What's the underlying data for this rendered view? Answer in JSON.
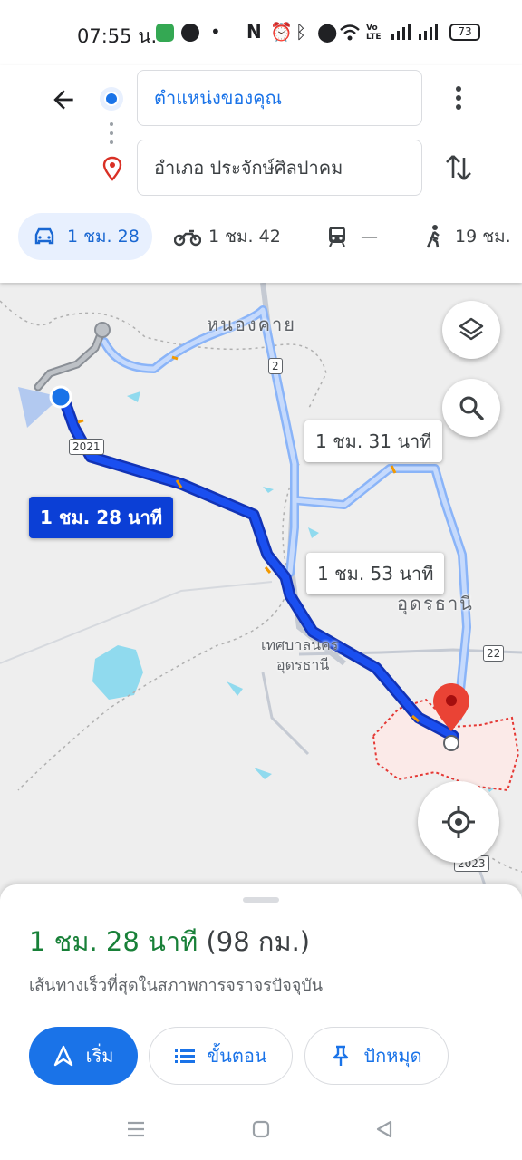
{
  "status_bar": {
    "time": "07:55 น.",
    "app_icons": [
      "messages-app-icon",
      "line-app-icon"
    ],
    "system_icons": [
      "nfc-icon",
      "alarm-icon",
      "bluetooth-icon",
      "location-icon",
      "wifi-icon",
      "volte-icon",
      "signal-icon"
    ],
    "volte_label": "Vo\nLTE",
    "battery": "73"
  },
  "header": {
    "origin": "ตำแหน่งของคุณ",
    "destination": "อำเภอ ประจักษ์ศิลปาคม",
    "modes": [
      {
        "icon": "car-icon",
        "label": "1 ชม. 28",
        "selected": true
      },
      {
        "icon": "motorcycle-icon",
        "label": "1 ชม. 42"
      },
      {
        "icon": "transit-icon",
        "label": "—"
      },
      {
        "icon": "walk-icon",
        "label": "19 ชม."
      }
    ]
  },
  "map": {
    "place_labels": [
      "หนองคาย",
      "อุดรธานี",
      "เทศบาลนคร",
      "อุดรธานี"
    ],
    "road_shields": [
      "2",
      "2021",
      "22",
      "2023"
    ],
    "route_labels": {
      "primary": "1 ชม. 28 นาที",
      "alt1": "1 ชม. 31 นาที",
      "alt2": "1 ชม. 53 นาที"
    }
  },
  "sheet": {
    "duration": "1 ชม. 28 นาที",
    "distance": "(98 กม.)",
    "description": "เส้นทางเร็วที่สุดในสภาพการจราจรปัจจุบัน",
    "start_label": "เริ่ม",
    "steps_label": "ขั้นตอน",
    "pin_label": "ปักหมุด"
  },
  "colors": {
    "accent": "#1a73e8",
    "route_primary": "#1a3fe0",
    "route_alt": "#aecbfa",
    "duration_green": "#188038"
  }
}
